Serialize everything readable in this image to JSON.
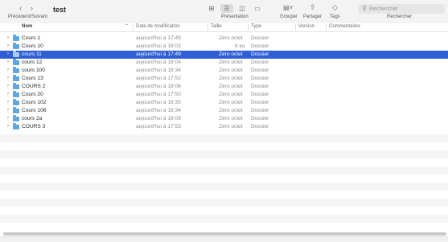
{
  "toolbar": {
    "back_icon": "chevron-left-icon",
    "forward_icon": "chevron-right-icon",
    "nav_label": "Précédent/Suivant",
    "title": "test",
    "view_label": "Présentation",
    "group_label": "Grouper",
    "share_label": "Partager",
    "tags_label": "Tags",
    "search_placeholder": "Rechercher",
    "search_label": "Rechercher"
  },
  "columns": {
    "name": "Nom",
    "date": "Date de modification",
    "size": "Taille",
    "kind": "Type",
    "version": "Version",
    "comments": "Commentaires"
  },
  "rows": [
    {
      "name": "Cours 1",
      "date": "aujourd'hui à 17:49",
      "size": "Zéro octet",
      "kind": "Dossier",
      "selected": false
    },
    {
      "name": "Cours 10",
      "date": "aujourd'hui à 18:02",
      "size": "6 ko",
      "kind": "Dossier",
      "selected": false
    },
    {
      "name": "cours 11",
      "date": "aujourd'hui à 17:49",
      "size": "Zéro octet",
      "kind": "Dossier",
      "selected": true
    },
    {
      "name": "cours 12",
      "date": "aujourd'hui à 18:04",
      "size": "Zéro octet",
      "kind": "Dossier",
      "selected": false
    },
    {
      "name": "cours 100",
      "date": "aujourd'hui à 18:34",
      "size": "Zéro octet",
      "kind": "Dossier",
      "selected": false
    },
    {
      "name": "Cours 13",
      "date": "aujourd'hui à 17:52",
      "size": "Zéro octet",
      "kind": "Dossier",
      "selected": false
    },
    {
      "name": "COURS 2",
      "date": "aujourd'hui à 18:06",
      "size": "Zéro octet",
      "kind": "Dossier",
      "selected": false
    },
    {
      "name": "Cours 20",
      "date": "aujourd'hui à 17:50",
      "size": "Zéro octet",
      "kind": "Dossier",
      "selected": false
    },
    {
      "name": "Cours 102",
      "date": "aujourd'hui à 18:35",
      "size": "Zéro octet",
      "kind": "Dossier",
      "selected": false
    },
    {
      "name": "Cours 106",
      "date": "aujourd'hui à 18:34",
      "size": "Zéro octet",
      "kind": "Dossier",
      "selected": false
    },
    {
      "name": "cours 2a",
      "date": "aujourd'hui à 18:08",
      "size": "Zéro octet",
      "kind": "Dossier",
      "selected": false
    },
    {
      "name": "COURS 3",
      "date": "aujourd'hui à 17:53",
      "size": "Zéro octet",
      "kind": "Dossier",
      "selected": false
    }
  ],
  "colors": {
    "selection": "#2f5fd3",
    "folder": "#5aa7e6",
    "toolbar_bg": "#f3f3f3"
  }
}
